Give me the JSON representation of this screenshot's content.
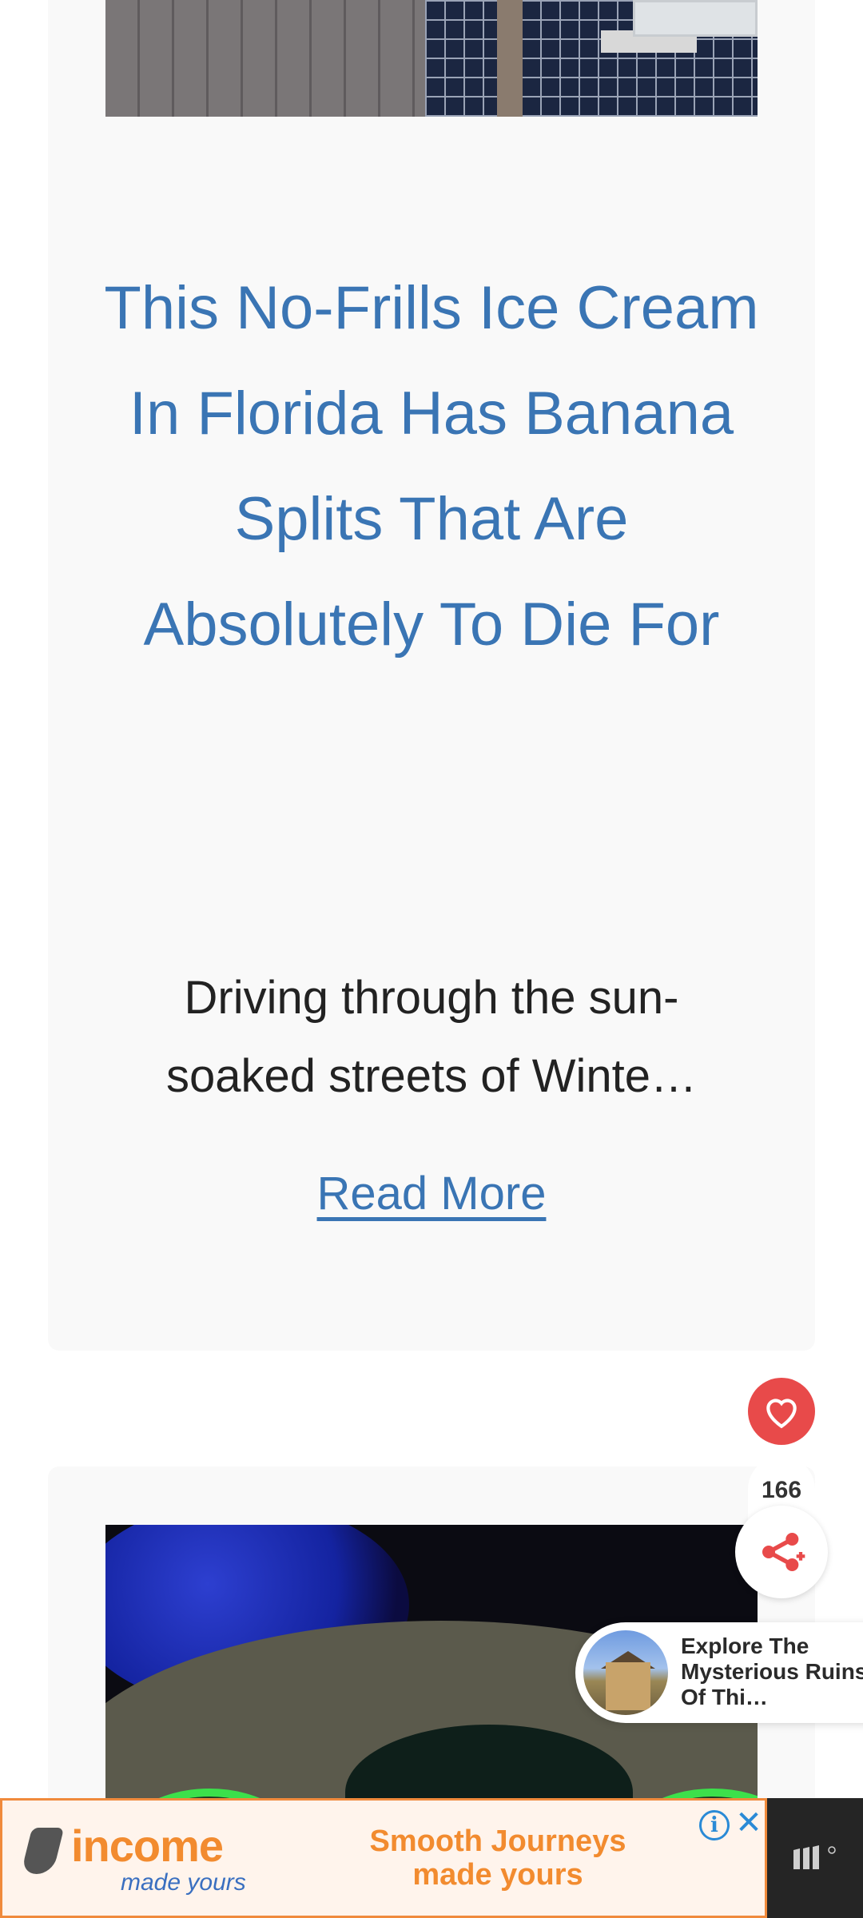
{
  "article": {
    "title": "This No-Frills Ice Cream In Florida Has Banana Splits That Are Absolutely To Die For",
    "excerpt": "Driving through the sun-soaked streets of Winte…",
    "read_more_label": "Read More"
  },
  "floating_actions": {
    "favorite_icon": "heart-icon",
    "share_count": "166",
    "share_icon": "share-icon",
    "accent_color": "#e84a4a"
  },
  "promo": {
    "text": "Explore The Mysterious Ruins Of Thi…"
  },
  "ad": {
    "brand": "income",
    "tagline": "made yours",
    "headline": "Smooth Journeys made yours",
    "info_icon": "info-icon",
    "close_icon": "close-icon",
    "brand_color": "#f28b2f"
  },
  "colors": {
    "link": "#3a75b4",
    "card_background": "#f9f9f9"
  }
}
